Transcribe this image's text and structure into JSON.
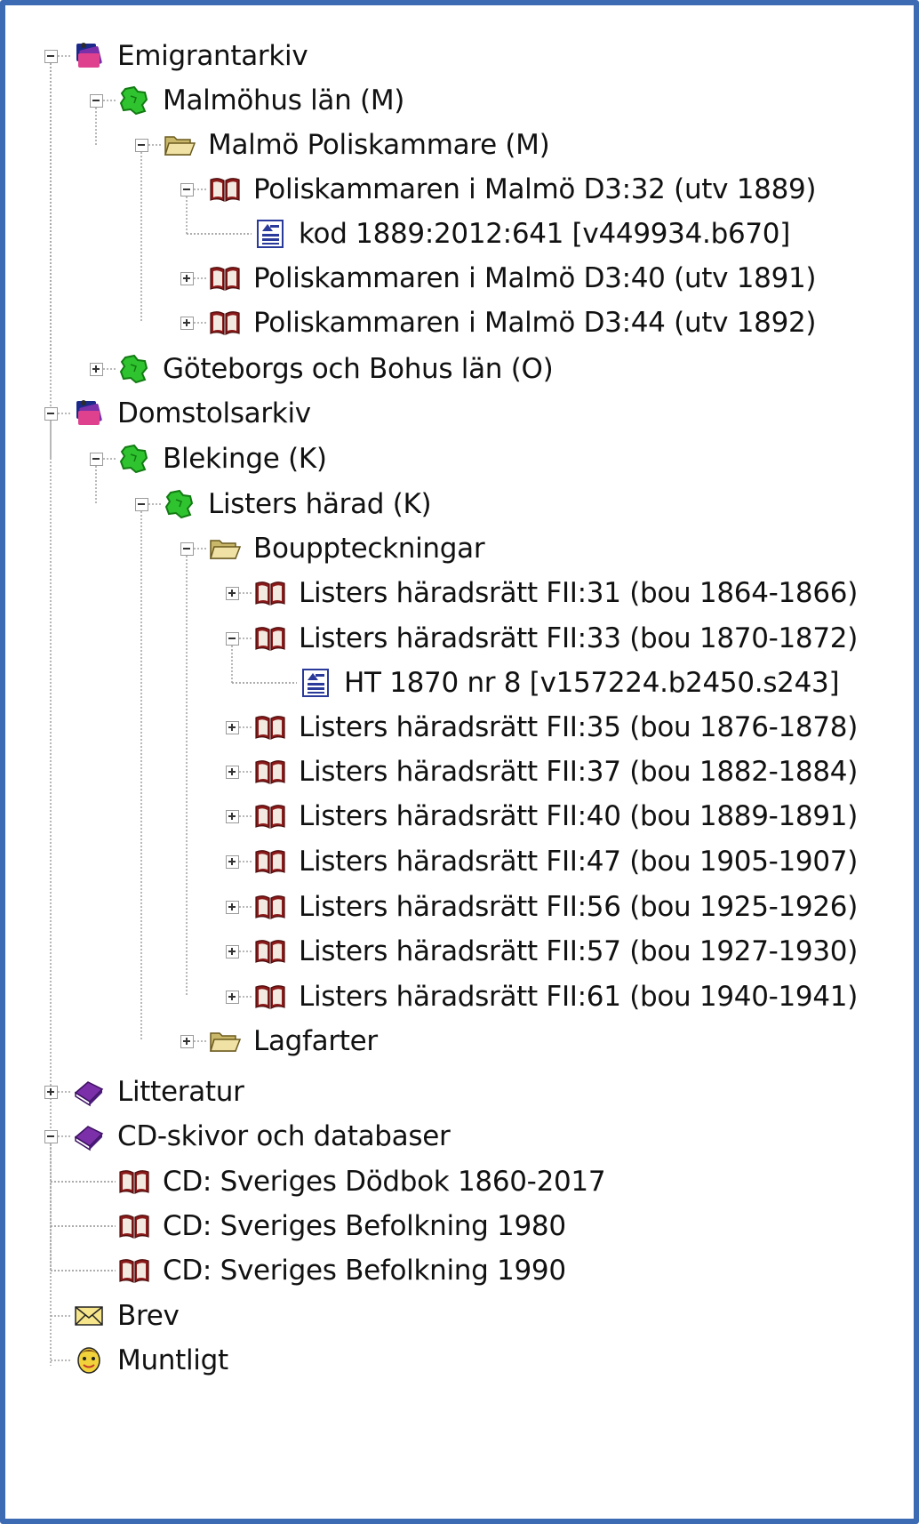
{
  "tree": {
    "items": [
      {
        "label": "Emigrantarkiv",
        "icon": "archive-icon",
        "expander": "minus"
      },
      {
        "label": "Malmöhus län (M)",
        "icon": "county-map-icon",
        "expander": "minus"
      },
      {
        "label": "Malmö Poliskammare (M)",
        "icon": "folder-open-icon",
        "expander": "minus"
      },
      {
        "label": "Poliskammaren i Malmö D3:32 (utv 1889)",
        "icon": "book-icon",
        "expander": "minus"
      },
      {
        "label": "kod 1889:2012:641 [v449934.b670]",
        "icon": "document-icon",
        "expander": "none"
      },
      {
        "label": "Poliskammaren i Malmö D3:40 (utv 1891)",
        "icon": "book-icon",
        "expander": "plus"
      },
      {
        "label": "Poliskammaren i Malmö D3:44 (utv 1892)",
        "icon": "book-icon",
        "expander": "plus"
      },
      {
        "label": "Göteborgs och Bohus län (O)",
        "icon": "county-map-icon",
        "expander": "plus"
      },
      {
        "label": "Domstolsarkiv",
        "icon": "archive-icon",
        "expander": "minus"
      },
      {
        "label": "Blekinge (K)",
        "icon": "county-map-icon",
        "expander": "minus"
      },
      {
        "label": "Listers härad (K)",
        "icon": "county-map-icon",
        "expander": "minus"
      },
      {
        "label": "Bouppteckningar",
        "icon": "folder-open-icon",
        "expander": "minus"
      },
      {
        "label": "Listers häradsrätt FII:31 (bou 1864-1866)",
        "icon": "book-icon",
        "expander": "plus"
      },
      {
        "label": "Listers häradsrätt FII:33 (bou 1870-1872)",
        "icon": "book-icon",
        "expander": "minus"
      },
      {
        "label": "HT 1870 nr 8 [v157224.b2450.s243]",
        "icon": "document-icon",
        "expander": "none"
      },
      {
        "label": "Listers häradsrätt FII:35 (bou 1876-1878)",
        "icon": "book-icon",
        "expander": "plus"
      },
      {
        "label": "Listers häradsrätt FII:37 (bou 1882-1884)",
        "icon": "book-icon",
        "expander": "plus"
      },
      {
        "label": "Listers häradsrätt FII:40 (bou 1889-1891)",
        "icon": "book-icon",
        "expander": "plus"
      },
      {
        "label": "Listers häradsrätt FII:47 (bou 1905-1907)",
        "icon": "book-icon",
        "expander": "plus"
      },
      {
        "label": "Listers häradsrätt FII:56 (bou 1925-1926)",
        "icon": "book-icon",
        "expander": "plus"
      },
      {
        "label": "Listers häradsrätt FII:57 (bou 1927-1930)",
        "icon": "book-icon",
        "expander": "plus"
      },
      {
        "label": "Listers häradsrätt FII:61 (bou 1940-1941)",
        "icon": "book-icon",
        "expander": "plus"
      },
      {
        "label": "Lagfarter",
        "icon": "folder-open-icon",
        "expander": "plus"
      },
      {
        "label": "Litteratur",
        "icon": "literature-book-icon",
        "expander": "plus"
      },
      {
        "label": "CD-skivor och databaser",
        "icon": "literature-book-icon",
        "expander": "minus"
      },
      {
        "label": "CD: Sveriges Dödbok 1860-2017",
        "icon": "book-icon",
        "expander": "none"
      },
      {
        "label": "CD: Sveriges Befolkning 1980",
        "icon": "book-icon",
        "expander": "none"
      },
      {
        "label": "CD: Sveriges Befolkning 1990",
        "icon": "book-icon",
        "expander": "none"
      },
      {
        "label": "Brev",
        "icon": "envelope-icon",
        "expander": "none"
      },
      {
        "label": "Muntligt",
        "icon": "face-icon",
        "expander": "none"
      }
    ]
  },
  "colors": {
    "frame": "#3d6bb3",
    "book": "#8b1a1a",
    "county": "#2fc42f",
    "folder": "#e8d68a",
    "archive": "#7b2fa8"
  }
}
